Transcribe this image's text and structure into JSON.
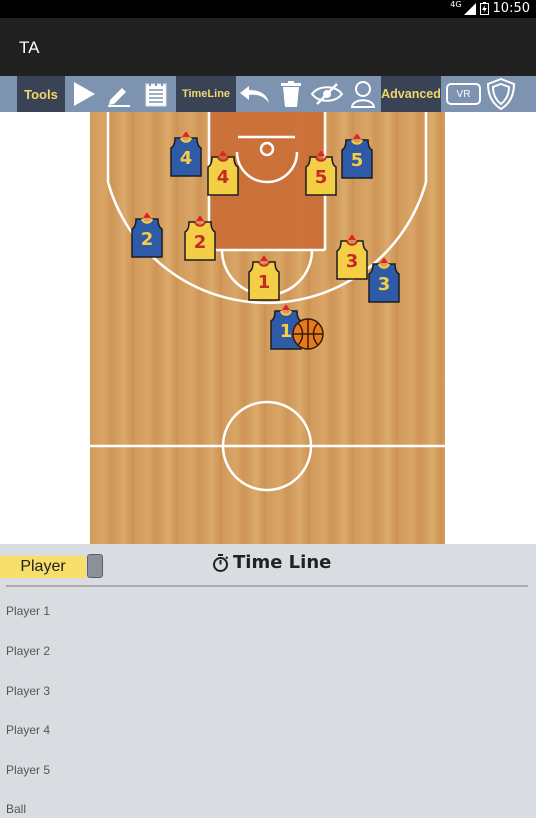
{
  "status_bar": {
    "network": "4G",
    "time": "10:50"
  },
  "app_bar": {
    "title": "TA"
  },
  "toolbar": {
    "tools_label": "Tools",
    "timeline_label": "TimeLine",
    "advanced_label": "Advanced",
    "vr_label": "VR"
  },
  "court": {
    "players": [
      {
        "team": "blue",
        "number": "4"
      },
      {
        "team": "blue",
        "number": "5"
      },
      {
        "team": "yellow",
        "number": "4"
      },
      {
        "team": "yellow",
        "number": "5"
      },
      {
        "team": "blue",
        "number": "2"
      },
      {
        "team": "yellow",
        "number": "2"
      },
      {
        "team": "yellow",
        "number": "3"
      },
      {
        "team": "blue",
        "number": "3"
      },
      {
        "team": "yellow",
        "number": "1"
      },
      {
        "team": "blue",
        "number": "1"
      }
    ],
    "colors": {
      "blue_team": "#2f5aa8",
      "yellow_team": "#f4cf45",
      "paint": "#c96a34",
      "ball": "#e57b1e"
    }
  },
  "timeline_panel": {
    "player_tab": "Player",
    "title": "Time Line",
    "rows": [
      "Player 1",
      "Player 2",
      "Player 3",
      "Player 4",
      "Player 5",
      "Ball"
    ]
  }
}
